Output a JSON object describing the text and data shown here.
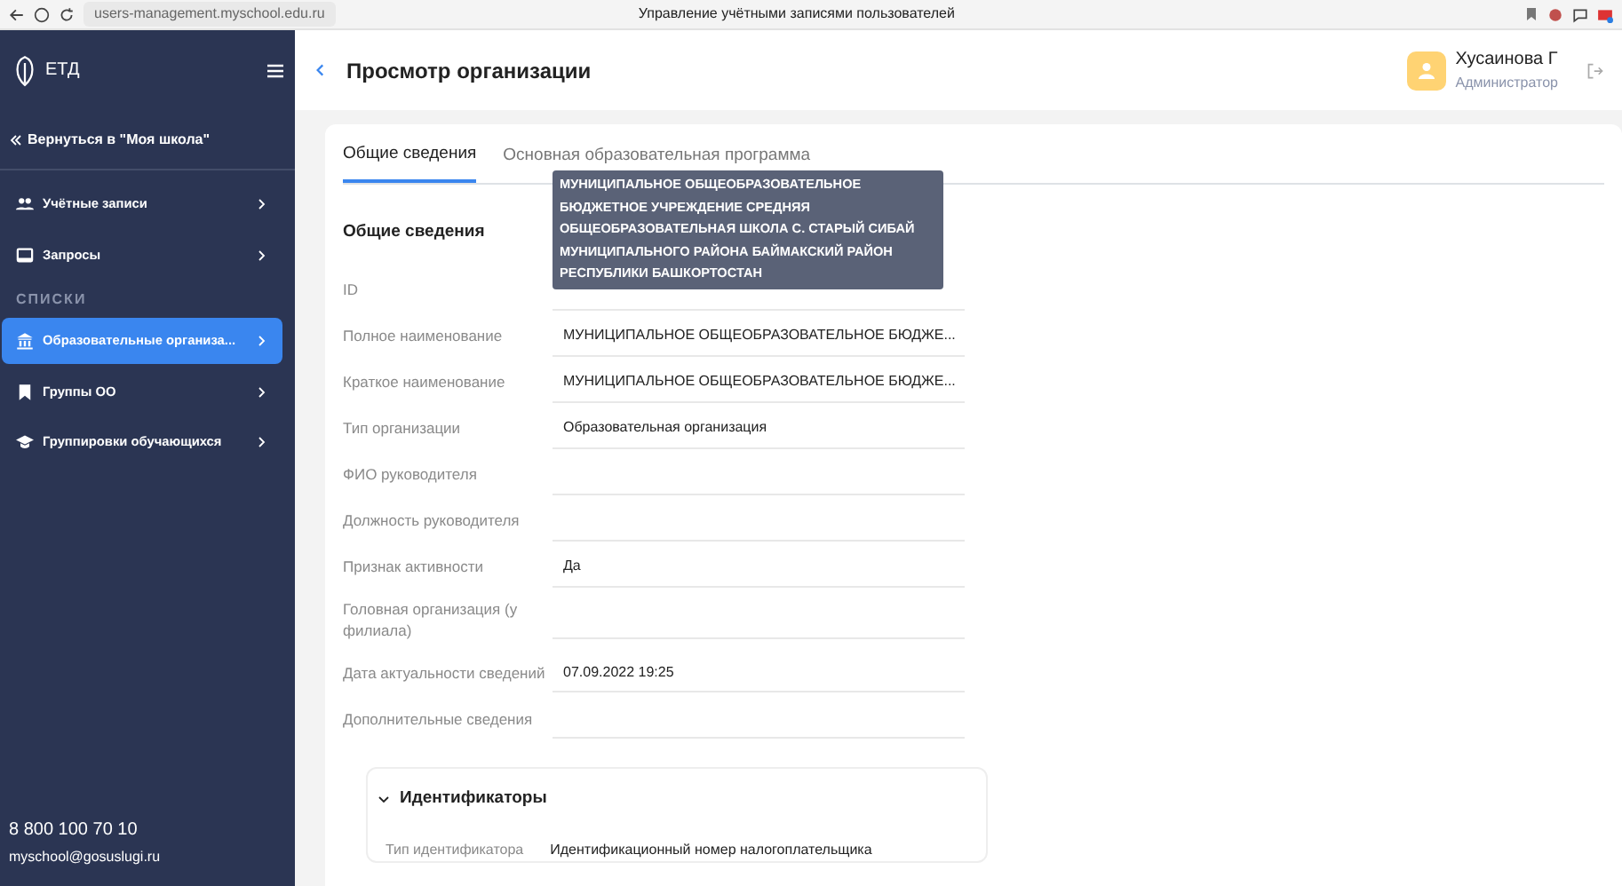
{
  "browser": {
    "url": "users-management.myschool.edu.ru",
    "title": "Управление учётными записями пользователей"
  },
  "sidebar": {
    "logo": "ЕТД",
    "back_link": "Вернуться в \"Моя школа\"",
    "nav": [
      {
        "kind": "item",
        "label": "Учётные записи",
        "selected": false
      },
      {
        "kind": "item",
        "label": "Запросы",
        "selected": false
      },
      {
        "kind": "heading",
        "label": "СПИСКИ"
      },
      {
        "kind": "item",
        "label": "Образовательные организа...",
        "selected": true
      },
      {
        "kind": "item",
        "label": "Группы ОО",
        "selected": false
      },
      {
        "kind": "item",
        "label": "Группировки обучающихся",
        "selected": false
      }
    ],
    "phone": "8 800 100 70 10",
    "email": "myschool@gosuslugi.ru"
  },
  "header": {
    "title": "Просмотр организации",
    "user_name": "Хусаинова Г",
    "user_role": "Администратор"
  },
  "tabs": [
    {
      "label": "Общие сведения",
      "selected": true
    },
    {
      "label": "Основная образовательная программа",
      "selected": false
    }
  ],
  "section_title": "Общие сведения",
  "tooltip": "МУНИЦИПАЛЬНОЕ ОБЩЕОБРАЗОВАТЕЛЬНОЕ БЮДЖЕТНОЕ УЧРЕЖДЕНИЕ СРЕДНЯЯ ОБЩЕОБРАЗОВАТЕЛЬНАЯ ШКОЛА С. СТАРЫЙ СИБАЙ МУНИЦИПАЛЬНОГО РАЙОНА БАЙМАКСКИЙ РАЙОН РЕСПУБЛИКИ БАШКОРТОСТАН",
  "fields": [
    {
      "label": "ID"
    },
    {
      "label": "Полное наименование",
      "value": "МУНИЦИПАЛЬНОЕ ОБЩЕОБРАЗОВАТЕЛЬНОЕ БЮДЖЕ..."
    },
    {
      "label": "Краткое наименование",
      "value": "МУНИЦИПАЛЬНОЕ ОБЩЕОБРАЗОВАТЕЛЬНОЕ БЮДЖЕ..."
    },
    {
      "label": "Тип организации",
      "value": "Образовательная организация"
    },
    {
      "label": "ФИО руководителя"
    },
    {
      "label": "Должность руководителя"
    },
    {
      "label": "Признак активности",
      "value": "Да"
    },
    {
      "label": "Головная организация (у филиала)"
    },
    {
      "label": "Дата актуальности сведений",
      "value": "07.09.2022 19:25"
    },
    {
      "label": "Дополнительные сведения"
    }
  ],
  "identifiers": {
    "title": "Идентификаторы",
    "expanded": true,
    "rows": [
      {
        "label": "Тип идентификатора",
        "value": "Идентификационный номер налогоплательщика"
      }
    ]
  }
}
